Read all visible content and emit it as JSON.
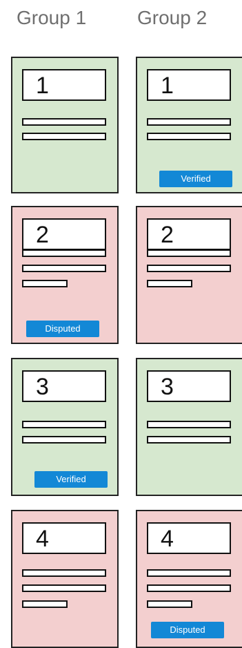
{
  "headers": {
    "group1": "Group 1",
    "group2": "Group 2"
  },
  "cards": {
    "g1c1": {
      "number": "1"
    },
    "g1c2": {
      "number": "2",
      "badge": "Disputed"
    },
    "g1c3": {
      "number": "3",
      "badge": "Verified"
    },
    "g1c4": {
      "number": "4"
    },
    "g2c1": {
      "number": "1",
      "badge": "Verified"
    },
    "g2c2": {
      "number": "2"
    },
    "g2c3": {
      "number": "3"
    },
    "g2c4": {
      "number": "4",
      "badge": "Disputed"
    }
  },
  "colors": {
    "verified_fill": "#d6e8cf",
    "disputed_fill": "#f3cfcf",
    "badge_fill": "#1388d6",
    "header_text": "#6f6f6f"
  }
}
